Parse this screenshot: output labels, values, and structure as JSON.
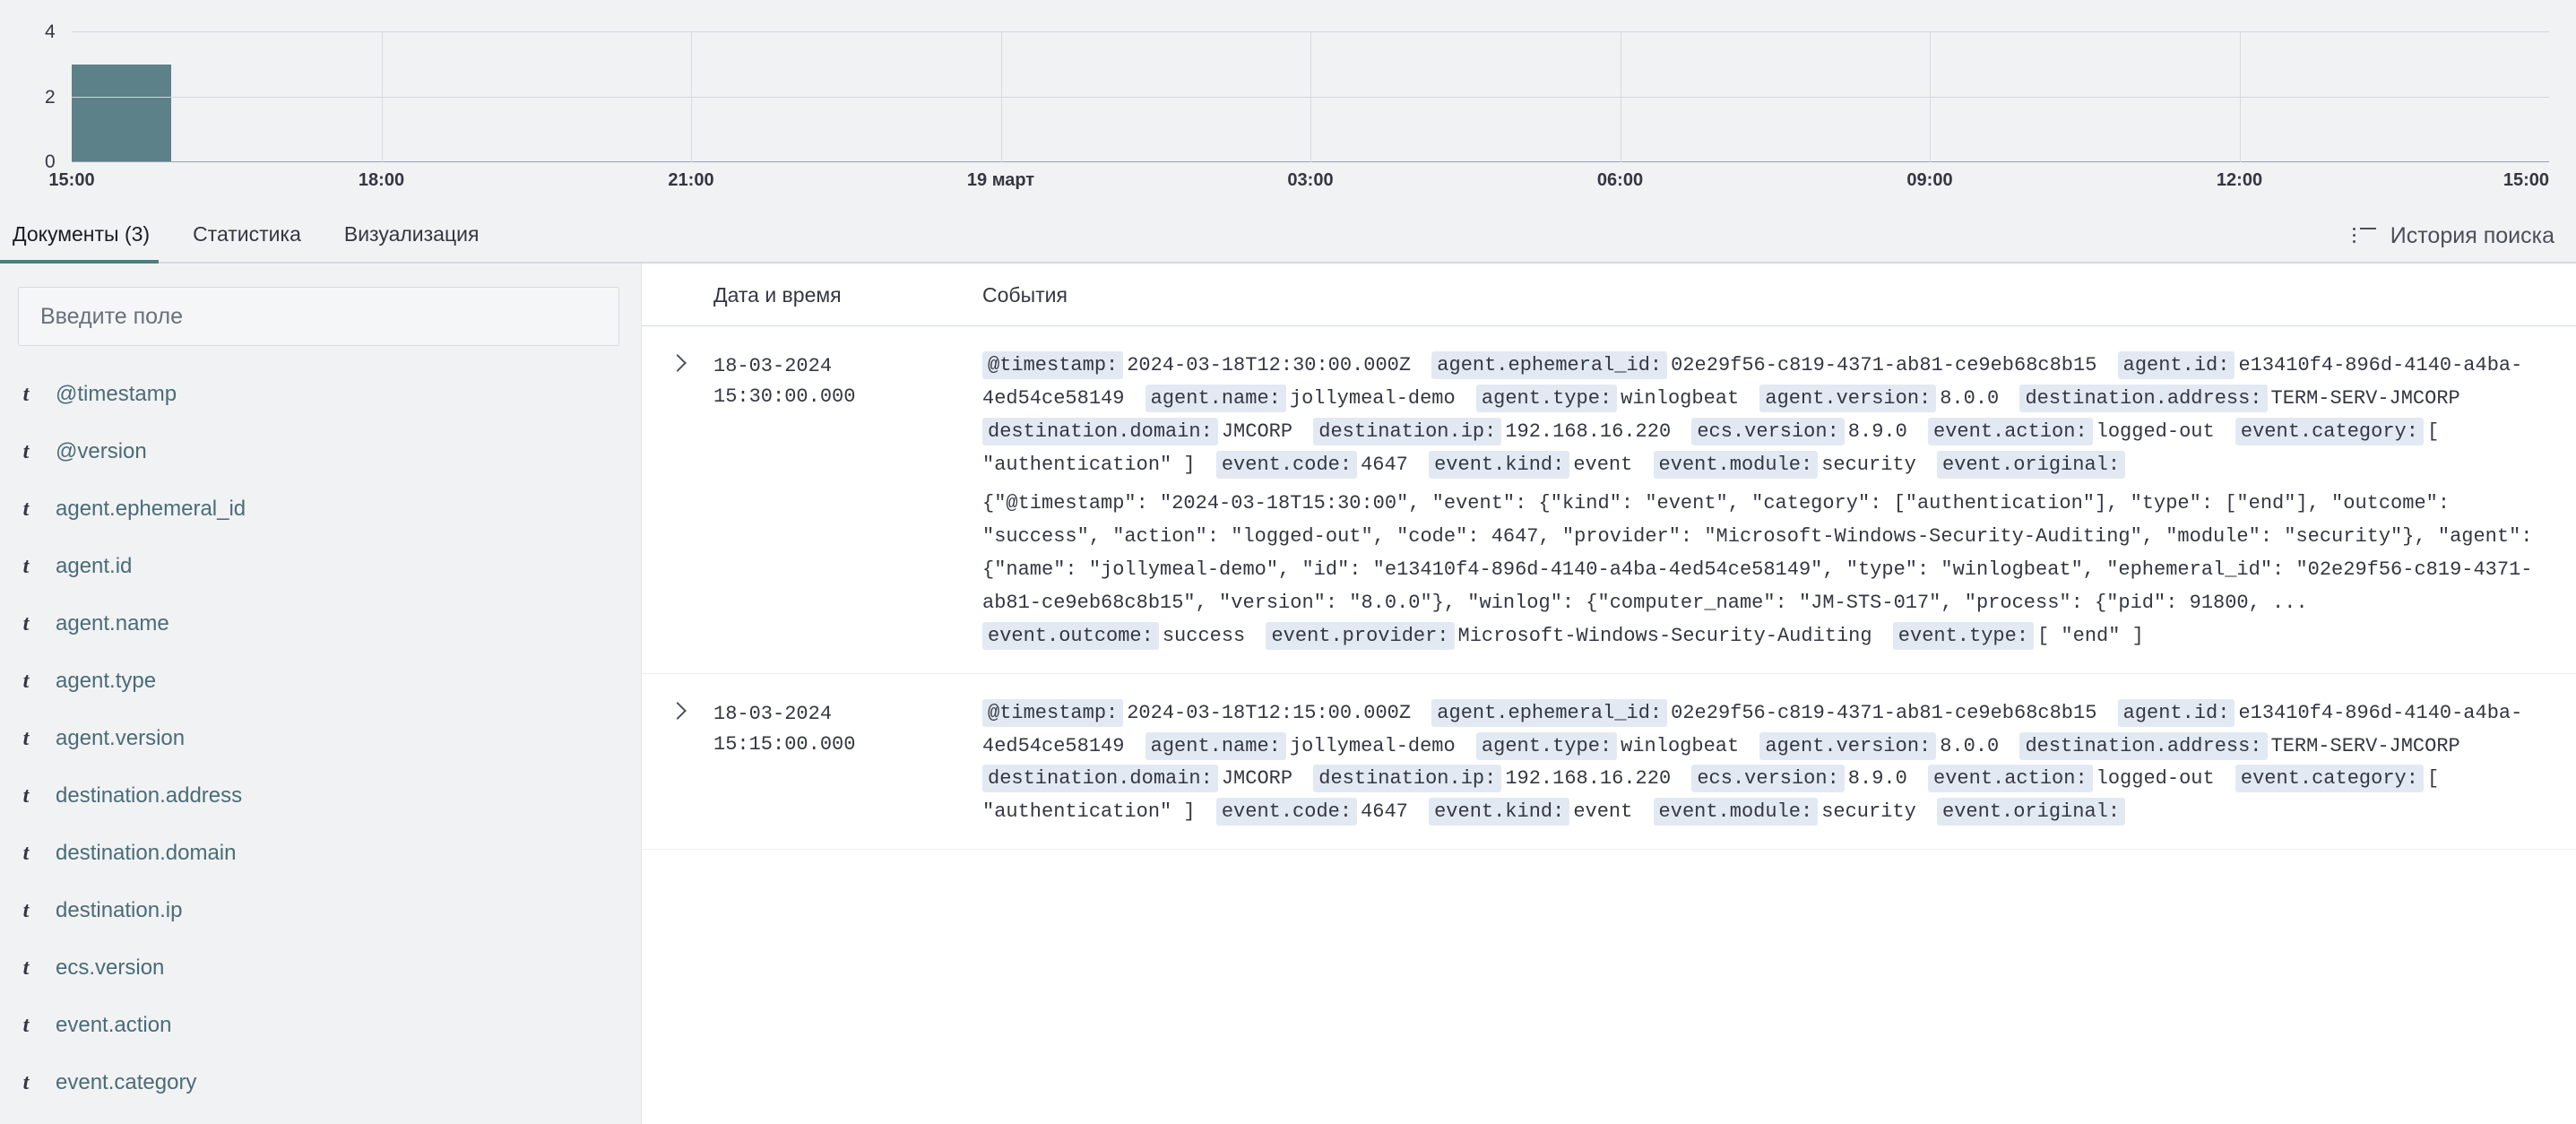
{
  "chart_data": {
    "type": "bar",
    "title": "",
    "xlabel": "",
    "ylabel": "",
    "categories": [
      "15:00",
      "18:00",
      "21:00",
      "19 март",
      "03:00",
      "06:00",
      "09:00",
      "12:00",
      "15:00"
    ],
    "x_tick_labels": [
      "15:00",
      "18:00",
      "21:00",
      "19 март",
      "03:00",
      "06:00",
      "09:00",
      "12:00",
      "15:00"
    ],
    "y_tick_labels": [
      "0",
      "2",
      "4"
    ],
    "ylim": [
      0,
      4
    ],
    "grid": true,
    "legend": "none",
    "bar_color": "#5c8189",
    "bars": [
      {
        "x": "15:00",
        "value": 3
      }
    ],
    "values": [
      3,
      0,
      0,
      0,
      0,
      0,
      0,
      0,
      0
    ]
  },
  "tabs": [
    {
      "label": "Документы (3)",
      "active": true
    },
    {
      "label": "Статистика",
      "active": false
    },
    {
      "label": "Визуализация",
      "active": false
    }
  ],
  "history_button": {
    "label": "История поиска",
    "icon": "list-icon"
  },
  "sidebar": {
    "search_placeholder": "Введите поле",
    "search_value": "",
    "fields": [
      {
        "type": "t",
        "name": "@timestamp"
      },
      {
        "type": "t",
        "name": "@version"
      },
      {
        "type": "t",
        "name": "agent.ephemeral_id"
      },
      {
        "type": "t",
        "name": "agent.id"
      },
      {
        "type": "t",
        "name": "agent.name"
      },
      {
        "type": "t",
        "name": "agent.type"
      },
      {
        "type": "t",
        "name": "agent.version"
      },
      {
        "type": "t",
        "name": "destination.address"
      },
      {
        "type": "t",
        "name": "destination.domain"
      },
      {
        "type": "t",
        "name": "destination.ip"
      },
      {
        "type": "t",
        "name": "ecs.version"
      },
      {
        "type": "t",
        "name": "event.action"
      },
      {
        "type": "t",
        "name": "event.category"
      }
    ]
  },
  "table": {
    "headers": {
      "time": "Дата и время",
      "events": "События"
    },
    "rows": [
      {
        "date": "18-03-2024",
        "time": "15:30:00.000",
        "pairs": [
          {
            "key": "@timestamp:",
            "value": "2024-03-18T12:30:00.000Z"
          },
          {
            "key": "agent.ephemeral_id:",
            "value": "02e29f56-c819-4371-ab81-ce9eb68c8b15"
          },
          {
            "key": "agent.id:",
            "value": "e13410f4-896d-4140-a4ba-4ed54ce58149"
          },
          {
            "key": "agent.name:",
            "value": "jollymeal-demo"
          },
          {
            "key": "agent.type:",
            "value": "winlogbeat"
          },
          {
            "key": "agent.version:",
            "value": "8.0.0"
          },
          {
            "key": "destination.address:",
            "value": "TERM-SERV-JMCORP"
          },
          {
            "key": "destination.domain:",
            "value": "JMCORP"
          },
          {
            "key": "destination.ip:",
            "value": "192.168.16.220"
          },
          {
            "key": "ecs.version:",
            "value": "8.9.0"
          },
          {
            "key": "event.action:",
            "value": "logged-out"
          },
          {
            "key": "event.category:",
            "value": "[ \"authentication\" ]"
          },
          {
            "key": "event.code:",
            "value": "4647"
          },
          {
            "key": "event.kind:",
            "value": "event"
          },
          {
            "key": "event.module:",
            "value": "security"
          },
          {
            "key": "event.original:",
            "value": ""
          }
        ],
        "original": "{\"@timestamp\": \"2024-03-18T15:30:00\", \"event\": {\"kind\": \"event\", \"category\": [\"authentication\"], \"type\": [\"end\"], \"outcome\": \"success\", \"action\": \"logged-out\", \"code\": 4647, \"provider\": \"Microsoft-Windows-Security-Auditing\", \"module\": \"security\"}, \"agent\": {\"name\": \"jollymeal-demo\", \"id\": \"e13410f4-896d-4140-a4ba-4ed54ce58149\", \"type\": \"winlogbeat\", \"ephemeral_id\": \"02e29f56-c819-4371-ab81-ce9eb68c8b15\", \"version\": \"8.0.0\"}, \"winlog\": {\"computer_name\": \"JM-STS-017\", \"process\": {\"pid\": 91800, ...",
        "tail_pairs": [
          {
            "key": "event.outcome:",
            "value": "success"
          },
          {
            "key": "event.provider:",
            "value": "Microsoft-Windows-Security-Auditing"
          },
          {
            "key": "event.type:",
            "value": "[ \"end\" ]"
          }
        ]
      },
      {
        "date": "18-03-2024",
        "time": "15:15:00.000",
        "pairs": [
          {
            "key": "@timestamp:",
            "value": "2024-03-18T12:15:00.000Z"
          },
          {
            "key": "agent.ephemeral_id:",
            "value": "02e29f56-c819-4371-ab81-ce9eb68c8b15"
          },
          {
            "key": "agent.id:",
            "value": "e13410f4-896d-4140-a4ba-4ed54ce58149"
          },
          {
            "key": "agent.name:",
            "value": "jollymeal-demo"
          },
          {
            "key": "agent.type:",
            "value": "winlogbeat"
          },
          {
            "key": "agent.version:",
            "value": "8.0.0"
          },
          {
            "key": "destination.address:",
            "value": "TERM-SERV-JMCORP"
          },
          {
            "key": "destination.domain:",
            "value": "JMCORP"
          },
          {
            "key": "destination.ip:",
            "value": "192.168.16.220"
          },
          {
            "key": "ecs.version:",
            "value": "8.9.0"
          },
          {
            "key": "event.action:",
            "value": "logged-out"
          },
          {
            "key": "event.category:",
            "value": "[ \"authentication\" ]"
          },
          {
            "key": "event.code:",
            "value": "4647"
          },
          {
            "key": "event.kind:",
            "value": "event"
          },
          {
            "key": "event.module:",
            "value": "security"
          },
          {
            "key": "event.original:",
            "value": ""
          }
        ],
        "original": "",
        "tail_pairs": []
      }
    ]
  }
}
